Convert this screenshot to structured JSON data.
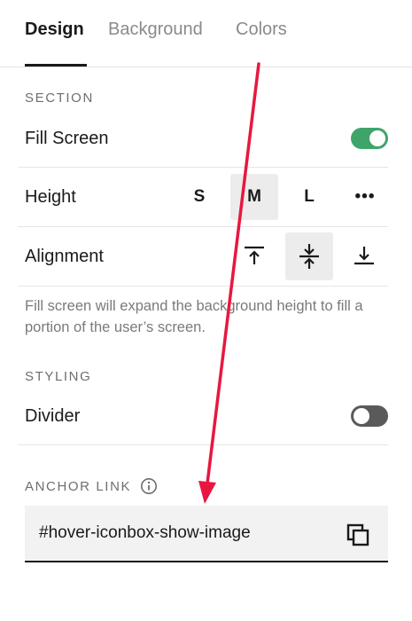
{
  "tabs": [
    {
      "label": "Design",
      "active": true
    },
    {
      "label": "Background",
      "active": false
    },
    {
      "label": "Colors",
      "active": false
    }
  ],
  "section": {
    "heading": "SECTION",
    "fill_screen": {
      "label": "Fill Screen",
      "enabled": true
    },
    "height": {
      "label": "Height",
      "options": [
        "S",
        "M",
        "L",
        "•••"
      ],
      "selected": "M"
    },
    "alignment": {
      "label": "Alignment",
      "options": [
        "align-top-icon",
        "align-center-icon",
        "align-bottom-icon"
      ],
      "selected": "align-center-icon"
    },
    "help_text": "Fill screen will expand the background height to fill a portion of the user’s screen."
  },
  "styling": {
    "heading": "STYLING",
    "divider": {
      "label": "Divider",
      "enabled": false
    }
  },
  "anchor_link": {
    "heading": "ANCHOR LINK",
    "value": "#hover-iconbox-show-image",
    "icons": [
      "info-icon",
      "copy-icon"
    ]
  },
  "colors": {
    "accent_green": "#3fa46a",
    "annotation_arrow": "#e8173f"
  }
}
